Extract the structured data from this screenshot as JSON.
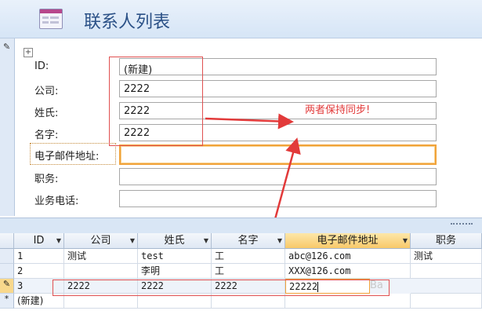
{
  "header": {
    "title": "联系人列表",
    "icon": "form-icon"
  },
  "form": {
    "record_selector_icon": "pencil-icon",
    "fields": [
      {
        "label": "ID:",
        "value": "(新建)"
      },
      {
        "label": "公司:",
        "value": "2222"
      },
      {
        "label": "姓氏:",
        "value": "2222"
      },
      {
        "label": "名字:",
        "value": "2222"
      },
      {
        "label": "电子邮件地址:",
        "value": ""
      },
      {
        "label": "职务:",
        "value": ""
      },
      {
        "label": "业务电话:",
        "value": ""
      }
    ],
    "annotation": "两者保持同步!",
    "annotation_color": "#e23a3a"
  },
  "datasheet": {
    "columns": [
      "ID",
      "公司",
      "姓氏",
      "名字",
      "电子邮件地址",
      "职务"
    ],
    "rows": [
      {
        "selector": "",
        "cells": [
          "1",
          "测试",
          "test",
          "工",
          "abc@126.com",
          "测试"
        ]
      },
      {
        "selector": "",
        "cells": [
          "2",
          "",
          "李明",
          "工",
          "XXX@126.com",
          ""
        ]
      },
      {
        "selector": "✎",
        "cells": [
          "3",
          "2222",
          "2222",
          "2222",
          "22222",
          ""
        ]
      },
      {
        "selector": "*",
        "cells": [
          "(新建)",
          "",
          "",
          "",
          "",
          ""
        ]
      }
    ],
    "watermark": "Ba"
  },
  "colors": {
    "accent": "#f1a33a",
    "header_blue": "#2b5187",
    "annotation_red": "#e05050"
  }
}
